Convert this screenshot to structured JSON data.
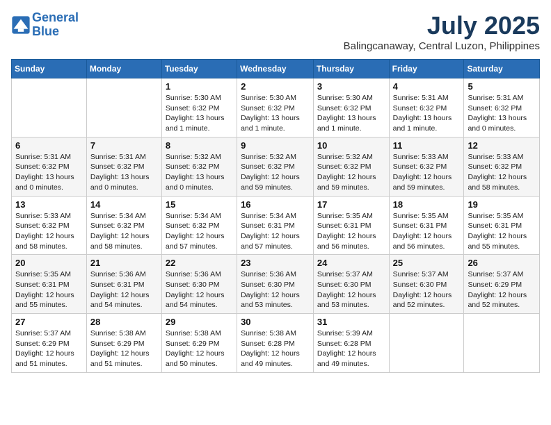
{
  "header": {
    "logo_line1": "General",
    "logo_line2": "Blue",
    "month": "July 2025",
    "location": "Balingcanaway, Central Luzon, Philippines"
  },
  "days_of_week": [
    "Sunday",
    "Monday",
    "Tuesday",
    "Wednesday",
    "Thursday",
    "Friday",
    "Saturday"
  ],
  "weeks": [
    [
      {
        "day": "",
        "info": ""
      },
      {
        "day": "",
        "info": ""
      },
      {
        "day": "1",
        "info": "Sunrise: 5:30 AM\nSunset: 6:32 PM\nDaylight: 13 hours and 1 minute."
      },
      {
        "day": "2",
        "info": "Sunrise: 5:30 AM\nSunset: 6:32 PM\nDaylight: 13 hours and 1 minute."
      },
      {
        "day": "3",
        "info": "Sunrise: 5:30 AM\nSunset: 6:32 PM\nDaylight: 13 hours and 1 minute."
      },
      {
        "day": "4",
        "info": "Sunrise: 5:31 AM\nSunset: 6:32 PM\nDaylight: 13 hours and 1 minute."
      },
      {
        "day": "5",
        "info": "Sunrise: 5:31 AM\nSunset: 6:32 PM\nDaylight: 13 hours and 0 minutes."
      }
    ],
    [
      {
        "day": "6",
        "info": "Sunrise: 5:31 AM\nSunset: 6:32 PM\nDaylight: 13 hours and 0 minutes."
      },
      {
        "day": "7",
        "info": "Sunrise: 5:31 AM\nSunset: 6:32 PM\nDaylight: 13 hours and 0 minutes."
      },
      {
        "day": "8",
        "info": "Sunrise: 5:32 AM\nSunset: 6:32 PM\nDaylight: 13 hours and 0 minutes."
      },
      {
        "day": "9",
        "info": "Sunrise: 5:32 AM\nSunset: 6:32 PM\nDaylight: 12 hours and 59 minutes."
      },
      {
        "day": "10",
        "info": "Sunrise: 5:32 AM\nSunset: 6:32 PM\nDaylight: 12 hours and 59 minutes."
      },
      {
        "day": "11",
        "info": "Sunrise: 5:33 AM\nSunset: 6:32 PM\nDaylight: 12 hours and 59 minutes."
      },
      {
        "day": "12",
        "info": "Sunrise: 5:33 AM\nSunset: 6:32 PM\nDaylight: 12 hours and 58 minutes."
      }
    ],
    [
      {
        "day": "13",
        "info": "Sunrise: 5:33 AM\nSunset: 6:32 PM\nDaylight: 12 hours and 58 minutes."
      },
      {
        "day": "14",
        "info": "Sunrise: 5:34 AM\nSunset: 6:32 PM\nDaylight: 12 hours and 58 minutes."
      },
      {
        "day": "15",
        "info": "Sunrise: 5:34 AM\nSunset: 6:32 PM\nDaylight: 12 hours and 57 minutes."
      },
      {
        "day": "16",
        "info": "Sunrise: 5:34 AM\nSunset: 6:31 PM\nDaylight: 12 hours and 57 minutes."
      },
      {
        "day": "17",
        "info": "Sunrise: 5:35 AM\nSunset: 6:31 PM\nDaylight: 12 hours and 56 minutes."
      },
      {
        "day": "18",
        "info": "Sunrise: 5:35 AM\nSunset: 6:31 PM\nDaylight: 12 hours and 56 minutes."
      },
      {
        "day": "19",
        "info": "Sunrise: 5:35 AM\nSunset: 6:31 PM\nDaylight: 12 hours and 55 minutes."
      }
    ],
    [
      {
        "day": "20",
        "info": "Sunrise: 5:35 AM\nSunset: 6:31 PM\nDaylight: 12 hours and 55 minutes."
      },
      {
        "day": "21",
        "info": "Sunrise: 5:36 AM\nSunset: 6:31 PM\nDaylight: 12 hours and 54 minutes."
      },
      {
        "day": "22",
        "info": "Sunrise: 5:36 AM\nSunset: 6:30 PM\nDaylight: 12 hours and 54 minutes."
      },
      {
        "day": "23",
        "info": "Sunrise: 5:36 AM\nSunset: 6:30 PM\nDaylight: 12 hours and 53 minutes."
      },
      {
        "day": "24",
        "info": "Sunrise: 5:37 AM\nSunset: 6:30 PM\nDaylight: 12 hours and 53 minutes."
      },
      {
        "day": "25",
        "info": "Sunrise: 5:37 AM\nSunset: 6:30 PM\nDaylight: 12 hours and 52 minutes."
      },
      {
        "day": "26",
        "info": "Sunrise: 5:37 AM\nSunset: 6:29 PM\nDaylight: 12 hours and 52 minutes."
      }
    ],
    [
      {
        "day": "27",
        "info": "Sunrise: 5:37 AM\nSunset: 6:29 PM\nDaylight: 12 hours and 51 minutes."
      },
      {
        "day": "28",
        "info": "Sunrise: 5:38 AM\nSunset: 6:29 PM\nDaylight: 12 hours and 51 minutes."
      },
      {
        "day": "29",
        "info": "Sunrise: 5:38 AM\nSunset: 6:29 PM\nDaylight: 12 hours and 50 minutes."
      },
      {
        "day": "30",
        "info": "Sunrise: 5:38 AM\nSunset: 6:28 PM\nDaylight: 12 hours and 49 minutes."
      },
      {
        "day": "31",
        "info": "Sunrise: 5:39 AM\nSunset: 6:28 PM\nDaylight: 12 hours and 49 minutes."
      },
      {
        "day": "",
        "info": ""
      },
      {
        "day": "",
        "info": ""
      }
    ]
  ]
}
